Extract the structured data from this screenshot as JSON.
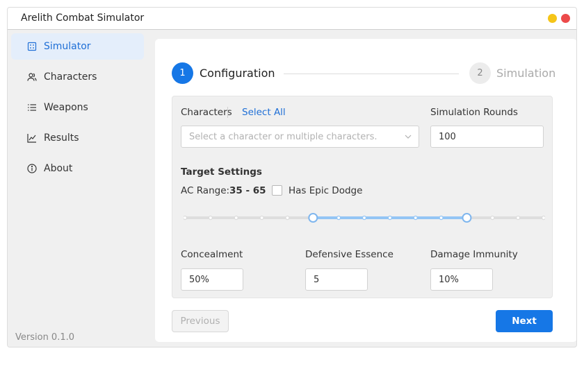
{
  "app": {
    "title": "Arelith Combat Simulator",
    "version": "Version 0.1.0"
  },
  "colors": {
    "accent": "#1677e6",
    "active_bg": "#e4eefb",
    "window_min": "#f5c518",
    "window_close": "#ec4a4a"
  },
  "sidebar": {
    "items": [
      {
        "label": "Simulator",
        "icon": "simulator-icon",
        "active": true
      },
      {
        "label": "Characters",
        "icon": "characters-icon",
        "active": false
      },
      {
        "label": "Weapons",
        "icon": "list-icon",
        "active": false
      },
      {
        "label": "Results",
        "icon": "chart-icon",
        "active": false
      },
      {
        "label": "About",
        "icon": "info-icon",
        "active": false
      }
    ]
  },
  "steps": [
    {
      "number": "1",
      "label": "Configuration",
      "active": true
    },
    {
      "number": "2",
      "label": "Simulation",
      "active": false
    }
  ],
  "form": {
    "characters_label": "Characters",
    "select_all": "Select All",
    "characters_placeholder": "Select a character or multiple characters.",
    "rounds_label": "Simulation Rounds",
    "rounds_value": "100",
    "target_settings": "Target Settings",
    "ac_range_label": "AC Range:",
    "ac_range_value": "35 - 65",
    "ac_min": 35,
    "ac_max": 65,
    "epic_dodge_label": "Has Epic Dodge",
    "epic_dodge_checked": false,
    "concealment_label": "Concealment",
    "concealment_value": "50%",
    "defensive_essence_label": "Defensive Essence",
    "defensive_essence_value": "5",
    "damage_immunity_label": "Damage Immunity",
    "damage_immunity_value": "10%"
  },
  "buttons": {
    "previous": "Previous",
    "next": "Next"
  }
}
